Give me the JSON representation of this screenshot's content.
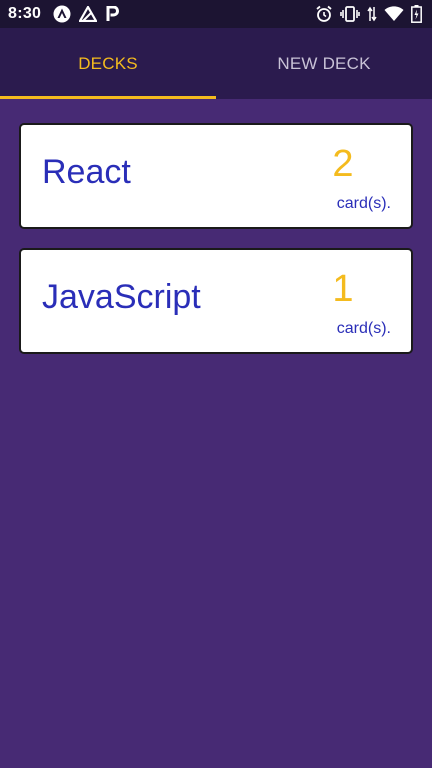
{
  "status_bar": {
    "time": "8:30",
    "left_icons": [
      "react-native-icon",
      "arrow-triangle-icon",
      "parking-icon"
    ],
    "right_icons": [
      "alarm-icon",
      "vibrate-icon",
      "data-arrows-icon",
      "wifi-icon",
      "battery-icon"
    ]
  },
  "tabs": [
    {
      "label": "DECKS",
      "active": true
    },
    {
      "label": "NEW DECK",
      "active": false
    }
  ],
  "decks": [
    {
      "title": "React",
      "count": "2",
      "count_label": "card(s)."
    },
    {
      "title": "JavaScript",
      "count": "1",
      "count_label": "card(s)."
    }
  ],
  "colors": {
    "background": "#472a74",
    "tab_bar": "#2b1b4e",
    "accent": "#f4bb1e",
    "deck_title": "#2a2eb8",
    "card": "#ffffff"
  }
}
